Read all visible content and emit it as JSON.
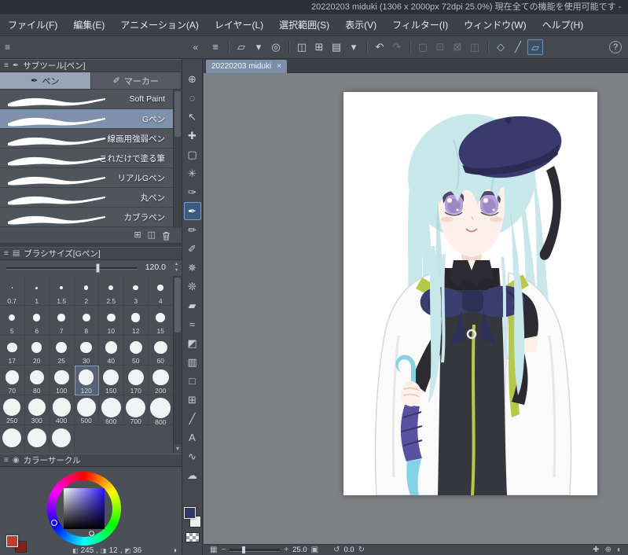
{
  "window": {
    "title": "20220203 miduki (1306 x 2000px 72dpi 25.0%) 現在全ての機能を使用可能です -"
  },
  "menu": {
    "items": [
      {
        "name": "file",
        "label": "ファイル(F)"
      },
      {
        "name": "edit",
        "label": "編集(E)"
      },
      {
        "name": "animation",
        "label": "アニメーション(A)"
      },
      {
        "name": "layer",
        "label": "レイヤー(L)"
      },
      {
        "name": "selection",
        "label": "選択範囲(S)"
      },
      {
        "name": "view",
        "label": "表示(V)"
      },
      {
        "name": "filter",
        "label": "フィルター(I)"
      },
      {
        "name": "window",
        "label": "ウィンドウ(W)"
      },
      {
        "name": "help",
        "label": "ヘルプ(H)"
      }
    ]
  },
  "toolbar": {
    "left_menu_glyph": "≡",
    "collapse_glyph": "«",
    "help_glyph": "?",
    "groups": [
      {
        "icons": [
          {
            "name": "main-menu",
            "glyph": "≡"
          }
        ]
      },
      {
        "icons": [
          {
            "name": "new-canvas",
            "glyph": "▱"
          },
          {
            "name": "chevron-down",
            "glyph": "▾"
          },
          {
            "name": "register-material",
            "glyph": "◎"
          }
        ]
      },
      {
        "icons": [
          {
            "name": "copy",
            "glyph": "◫"
          },
          {
            "name": "paste-new",
            "glyph": "⊞"
          },
          {
            "name": "print",
            "glyph": "▤"
          },
          {
            "name": "chevron-down",
            "glyph": "▾"
          }
        ]
      },
      {
        "icons": [
          {
            "name": "undo",
            "glyph": "↶"
          },
          {
            "name": "redo",
            "glyph": "↷",
            "state": "disabled"
          }
        ]
      },
      {
        "icons": [
          {
            "name": "deselect",
            "glyph": "▢",
            "state": "disabled"
          },
          {
            "name": "reselect",
            "glyph": "⊡",
            "state": "disabled"
          },
          {
            "name": "invert-selection",
            "glyph": "⊠",
            "state": "disabled"
          },
          {
            "name": "selection-border",
            "glyph": "◫",
            "state": "disabled"
          }
        ]
      },
      {
        "icons": [
          {
            "name": "snap-to-ruler",
            "glyph": "◇",
            "state": "active"
          },
          {
            "name": "snap-to-special-ruler",
            "glyph": "╱",
            "state": "active"
          },
          {
            "name": "snap-to-grid",
            "glyph": "▱",
            "state": "active boxed"
          }
        ]
      }
    ]
  },
  "doc_tab": {
    "label": "20220203 miduki",
    "close": "×"
  },
  "subtool": {
    "title": "サブツール[ペン]",
    "tabs": [
      {
        "name": "pen",
        "label": "ペン",
        "glyph": "✒",
        "selected": true
      },
      {
        "name": "marker",
        "label": "マーカー",
        "glyph": "✐",
        "selected": false
      }
    ],
    "brushes": [
      {
        "name": "Soft Paint"
      },
      {
        "name": "Gペン",
        "selected": true
      },
      {
        "name": "線画用強弱ペン"
      },
      {
        "name": "これだけで塗る筆"
      },
      {
        "name": "リアルGペン"
      },
      {
        "name": "丸ペン"
      },
      {
        "name": "カブラペン"
      }
    ],
    "footer_icons": [
      {
        "name": "import",
        "glyph": "⊞"
      },
      {
        "name": "duplicate",
        "glyph": "◫"
      },
      {
        "name": "delete-trash",
        "glyph": "svg-trash"
      }
    ]
  },
  "brush_size": {
    "title": "ブラシサイズ[Gペン]",
    "value": "120.0",
    "selected": "120",
    "sizes": [
      "0.7",
      "1",
      "1.5",
      "2",
      "2.5",
      "3",
      "4",
      "5",
      "6",
      "7",
      "8",
      "10",
      "12",
      "15",
      "17",
      "20",
      "25",
      "30",
      "40",
      "50",
      "60",
      "70",
      "80",
      "100",
      "120",
      "150",
      "170",
      "200",
      "250",
      "300",
      "400",
      "500",
      "600",
      "700",
      "800"
    ],
    "partial_count": 3
  },
  "color_panel": {
    "title": "カラーサークル",
    "readout": [
      {
        "name": "hue",
        "icon": "◧",
        "value": "245"
      },
      {
        "name": "saturation",
        "icon": "◨",
        "value": "12"
      },
      {
        "name": "value",
        "icon": "◩",
        "value": "36"
      }
    ],
    "mode_toggle_glyph": "◑",
    "selected_hue_color": "#2a14ff",
    "foreground": "#2e3a63",
    "background": "#eef0f3"
  },
  "tools": [
    {
      "name": "zoom",
      "glyph": "⊕"
    },
    {
      "name": "pan",
      "glyph": "◌"
    },
    {
      "name": "operate",
      "glyph": "↖"
    },
    {
      "name": "layer-move",
      "glyph": "✚"
    },
    {
      "name": "marquee",
      "glyph": "▢"
    },
    {
      "name": "auto-select",
      "glyph": "✳"
    },
    {
      "name": "eyedropper",
      "glyph": "✑"
    },
    {
      "name": "pen",
      "glyph": "✒",
      "selected": true
    },
    {
      "name": "pencil",
      "glyph": "✏"
    },
    {
      "name": "brush",
      "glyph": "✐"
    },
    {
      "name": "airbrush",
      "glyph": "✵"
    },
    {
      "name": "decoration",
      "glyph": "❊"
    },
    {
      "name": "eraser",
      "glyph": "▰"
    },
    {
      "name": "blend",
      "glyph": "≈"
    },
    {
      "name": "fill",
      "glyph": "◩"
    },
    {
      "name": "gradient",
      "glyph": "▥"
    },
    {
      "name": "figure",
      "glyph": "□"
    },
    {
      "name": "frame-border",
      "glyph": "⊞"
    },
    {
      "name": "ruler",
      "glyph": "╱"
    },
    {
      "name": "text",
      "glyph": "A"
    },
    {
      "name": "line-correction",
      "glyph": "∿"
    },
    {
      "name": "balloon",
      "glyph": "☁"
    }
  ],
  "statusbar": {
    "zoom": "25.0",
    "rotation": "0.0"
  },
  "corner_swatches": {
    "front": "#c23b32",
    "back": "#7e241e"
  },
  "artwork": {
    "palette": {
      "hair": "#c8e7ea",
      "hair_shade": "#9fd2d8",
      "skin": "#fdf1ea",
      "eye": "#b5a0d6",
      "eye_dark": "#4e4766",
      "beret": "#3b3a6d",
      "beret_dark": "#2c2b55",
      "black": "#2b2b31",
      "suit": "#36373d",
      "green": "#b5c84b",
      "bow": "#3a3f70",
      "bow_dark": "#2d3158",
      "coat": "#fbfbfc",
      "coat_shade": "#e4e6ea",
      "umb_cyan": "#84d2e6",
      "umb_purple": "#5a52a0"
    }
  }
}
